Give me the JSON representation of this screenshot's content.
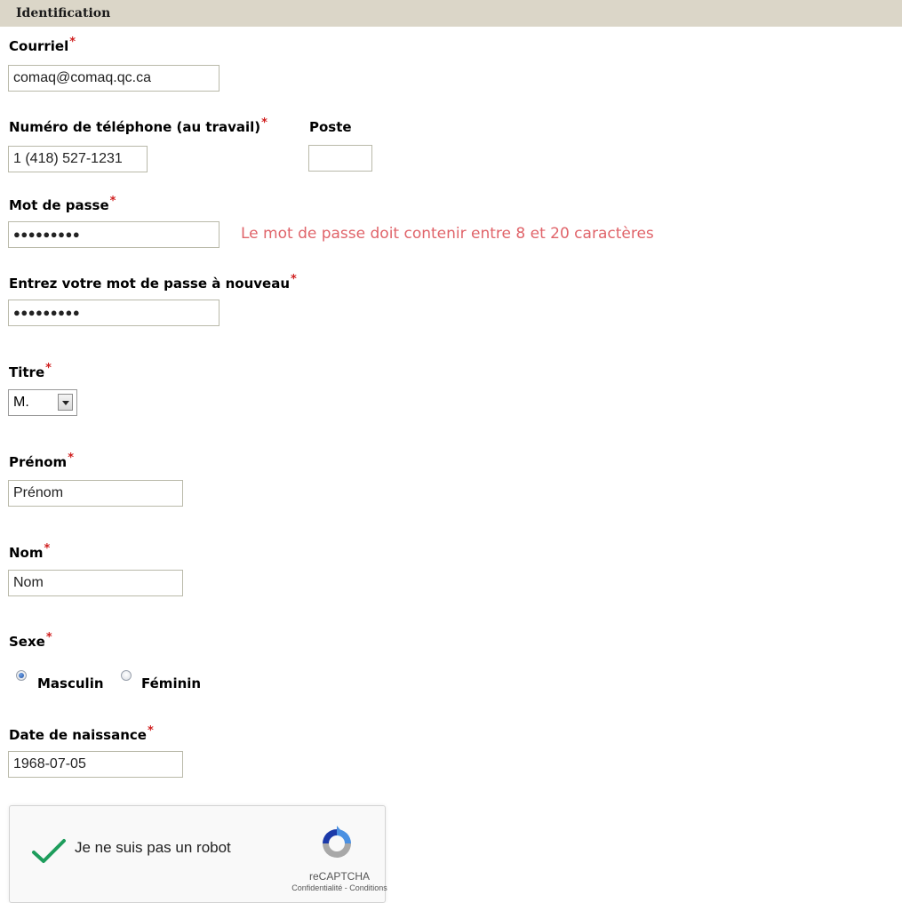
{
  "section": {
    "title": "Identification"
  },
  "fields": {
    "email": {
      "label": "Courriel",
      "value": "comaq@comaq.qc.ca"
    },
    "phone": {
      "label": "Numéro de téléphone (au travail)",
      "value": "1 (418) 527-1231"
    },
    "extension": {
      "label": "Poste",
      "value": ""
    },
    "password": {
      "label": "Mot de passe",
      "value": "●●●●●●●●●",
      "hint": "Le mot de passe doit contenir entre 8 et 20 caractères"
    },
    "password_confirm": {
      "label": "Entrez votre mot de passe à nouveau",
      "value": "●●●●●●●●●"
    },
    "title": {
      "label": "Titre",
      "value": "M."
    },
    "first_name": {
      "label": "Prénom",
      "value": "Prénom"
    },
    "last_name": {
      "label": "Nom",
      "value": "Nom"
    },
    "sex": {
      "label": "Sexe",
      "options": [
        {
          "label": "Masculin",
          "selected": true
        },
        {
          "label": "Féminin",
          "selected": false
        }
      ]
    },
    "birth_date": {
      "label": "Date de naissance",
      "value": "1968-07-05"
    }
  },
  "required_marker": "*",
  "recaptcha": {
    "label": "Je ne suis pas un robot",
    "brand": "reCAPTCHA",
    "terms": "Confidentialité - Conditions",
    "checked": true
  },
  "colors": {
    "header_bg": "#dbd6c8",
    "required": "#d01f1f",
    "hint": "#e0646a",
    "check": "#1e9d5c"
  },
  "icons": [
    "select-arrow-icon",
    "radio-icon",
    "checkmark-icon",
    "recaptcha-logo-icon"
  ]
}
